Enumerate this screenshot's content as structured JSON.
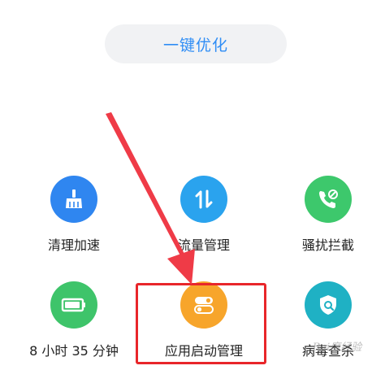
{
  "optimize": {
    "label": "一键优化"
  },
  "tiles": [
    {
      "label": "清理加速",
      "icon": "broom-icon",
      "color": "#2f86f0"
    },
    {
      "label": "流量管理",
      "icon": "up-down-arrows-icon",
      "color": "#2aa3ee"
    },
    {
      "label": "骚扰拦截",
      "icon": "phone-blocked-icon",
      "color": "#3dc86c"
    },
    {
      "label": "8 小时 35 分钟",
      "icon": "battery-icon",
      "color": "#3ec46a"
    },
    {
      "label": "应用启动管理",
      "icon": "toggle-switches-icon",
      "color": "#f7a52b"
    },
    {
      "label": "病毒查杀",
      "icon": "shield-search-icon",
      "color": "#1fb1c4"
    }
  ],
  "colors": {
    "highlight": "#e8262a",
    "accent": "#2f8df5"
  }
}
